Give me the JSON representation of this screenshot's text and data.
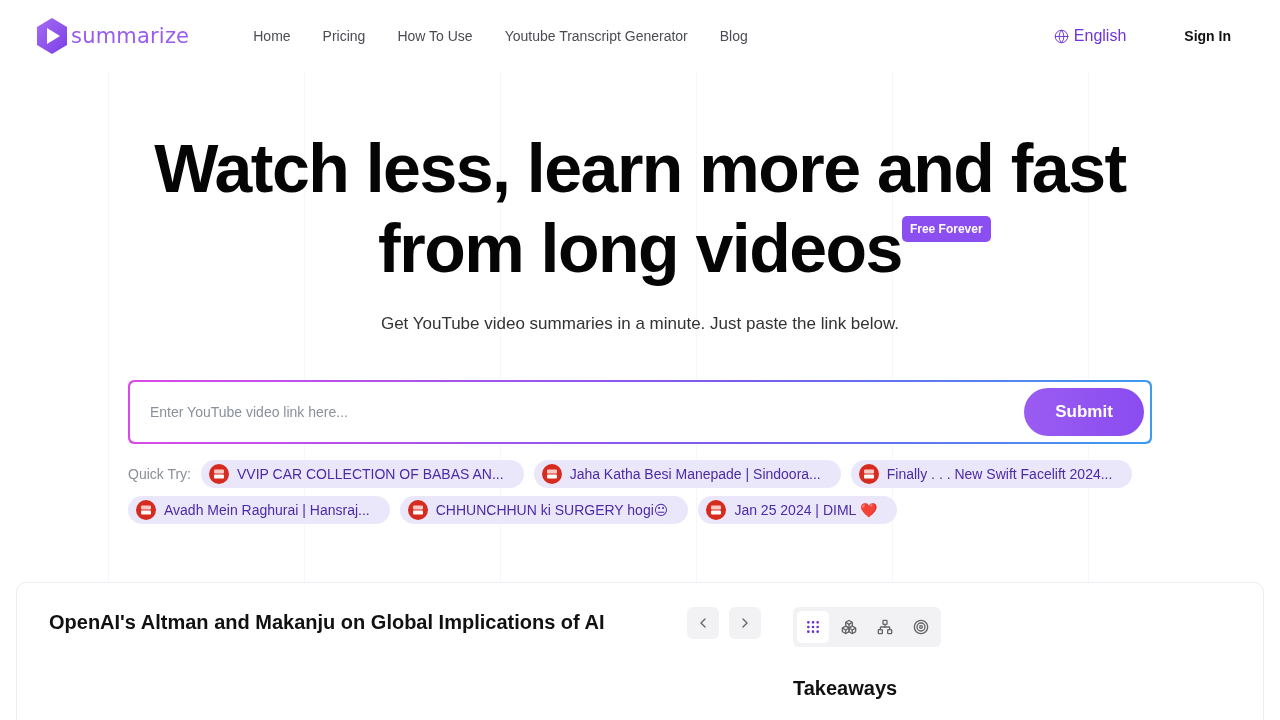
{
  "header": {
    "logo_text": "summarize",
    "nav": [
      {
        "label": "Home"
      },
      {
        "label": "Pricing"
      },
      {
        "label": "How To Use"
      },
      {
        "label": "Youtube Transcript Generator"
      },
      {
        "label": "Blog"
      }
    ],
    "language": "English",
    "sign_in": "Sign In"
  },
  "hero": {
    "title_line_1": "Watch less, learn more and fast",
    "title_line_2": "from long videos",
    "badge": "Free Forever",
    "subtitle": "Get YouTube video summaries in a minute. Just paste the link below."
  },
  "search": {
    "placeholder": "Enter YouTube video link here...",
    "submit": "Submit"
  },
  "quick_try": {
    "label": "Quick Try:",
    "items": [
      {
        "title": "VVIP CAR COLLECTION OF BABAS AN..."
      },
      {
        "title": "Jaha Katha Besi Manepade | Sindoora..."
      },
      {
        "title": "Finally . . . New Swift Facelift 2024..."
      },
      {
        "title": "Avadh Mein Raghurai | Hansraj..."
      },
      {
        "title": "CHHUNCHHUN ki SURGERY hogi😐"
      },
      {
        "title": "Jan 25 2024 | DIML ❤️"
      }
    ]
  },
  "summary_card": {
    "title": "OpenAI's Altman and Makanju on Global Implications of AI",
    "view_tabs": [
      {
        "kind": "takeaways",
        "selected": true
      },
      {
        "kind": "chapters",
        "selected": false
      },
      {
        "kind": "mindmap",
        "selected": false
      },
      {
        "kind": "focus",
        "selected": false
      }
    ],
    "section_heading": "Takeaways"
  }
}
